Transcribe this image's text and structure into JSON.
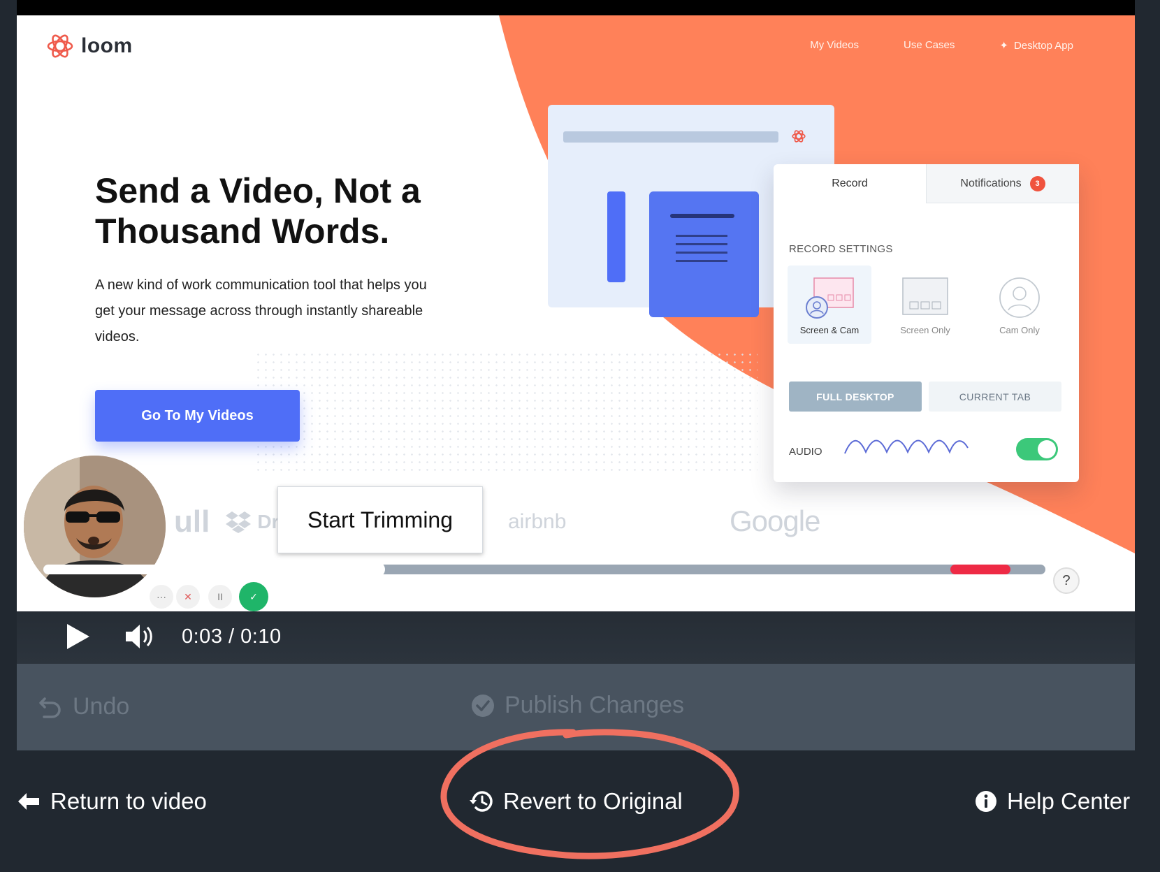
{
  "video": {
    "site": {
      "brand": "loom",
      "nav": [
        "My Videos",
        "Use Cases",
        "Desktop App"
      ],
      "hero_title": "Send a Video, Not a Thousand Words.",
      "hero_subtitle": "A new kind of work communication tool that helps you get your message across through instantly shareable videos.",
      "cta": "Go To My Videos",
      "logos": {
        "full": "ull",
        "dropbox": "Drop",
        "airbnb": "airbnb",
        "google": "Google"
      }
    },
    "recorder_panel": {
      "tab_record": "Record",
      "tab_notifications": "Notifications",
      "notifications_count": "3",
      "section_title": "RECORD SETTINGS",
      "modes": [
        "Screen & Cam",
        "Screen Only",
        "Cam Only"
      ],
      "full_desktop": "FULL DESKTOP",
      "current_tab": "CURRENT TAB",
      "audio_label": "AUDIO",
      "audio_on": true
    },
    "rec_controls": {
      "more": "···",
      "cancel": "✕",
      "pause": "II",
      "done": "✓"
    },
    "help_badge": "?",
    "trim_popup": "Start Trimming"
  },
  "player": {
    "current_time": "0:03",
    "separator": "/",
    "duration": "0:10",
    "progress_fraction": 0.333,
    "trim_red_range_fraction": [
      0.905,
      0.965
    ]
  },
  "editor": {
    "undo_label": "Undo",
    "publish_label": "Publish Changes"
  },
  "footer": {
    "return_label": "Return to video",
    "revert_label": "Revert to Original",
    "help_label": "Help Center"
  },
  "colors": {
    "accent_orange": "#ff8159",
    "cta_blue": "#4f6ef7",
    "trim_red": "#ee2a45",
    "annotation_circle": "#f07060"
  }
}
